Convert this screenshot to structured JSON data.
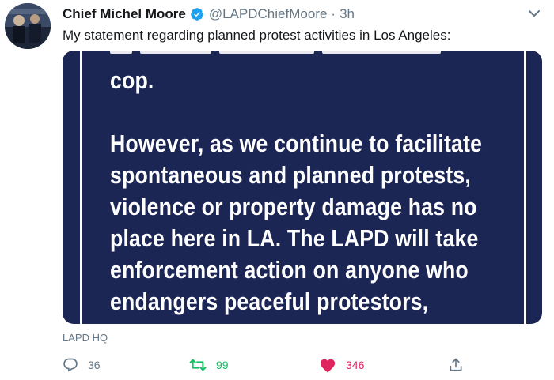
{
  "tweet": {
    "author_name": "Chief Michel Moore",
    "handle": "@LAPDChiefMoore",
    "separator": "·",
    "time": "3h",
    "text": "My statement regarding planned protest activities in Los Angeles:",
    "location": "LAPD HQ"
  },
  "media": {
    "lines": [
      "cop.",
      "",
      "However, as we continue to facilitate",
      "spontaneous and planned protests,",
      "violence or property damage has no",
      "place here in LA. The LAPD will take",
      "enforcement action on anyone who",
      "endangers peaceful protestors,"
    ]
  },
  "actions": {
    "reply_count": "36",
    "retweet_count": "99",
    "like_count": "346"
  },
  "icons": {
    "verified": "verified-badge-icon",
    "caret": "chevron-down-icon",
    "reply": "reply-icon",
    "retweet": "retweet-icon",
    "like": "heart-icon",
    "share": "share-icon"
  },
  "colors": {
    "verified": "#1da1f2",
    "retweet": "#17bf63",
    "like": "#e0245e",
    "media_bg": "#1c2655"
  }
}
